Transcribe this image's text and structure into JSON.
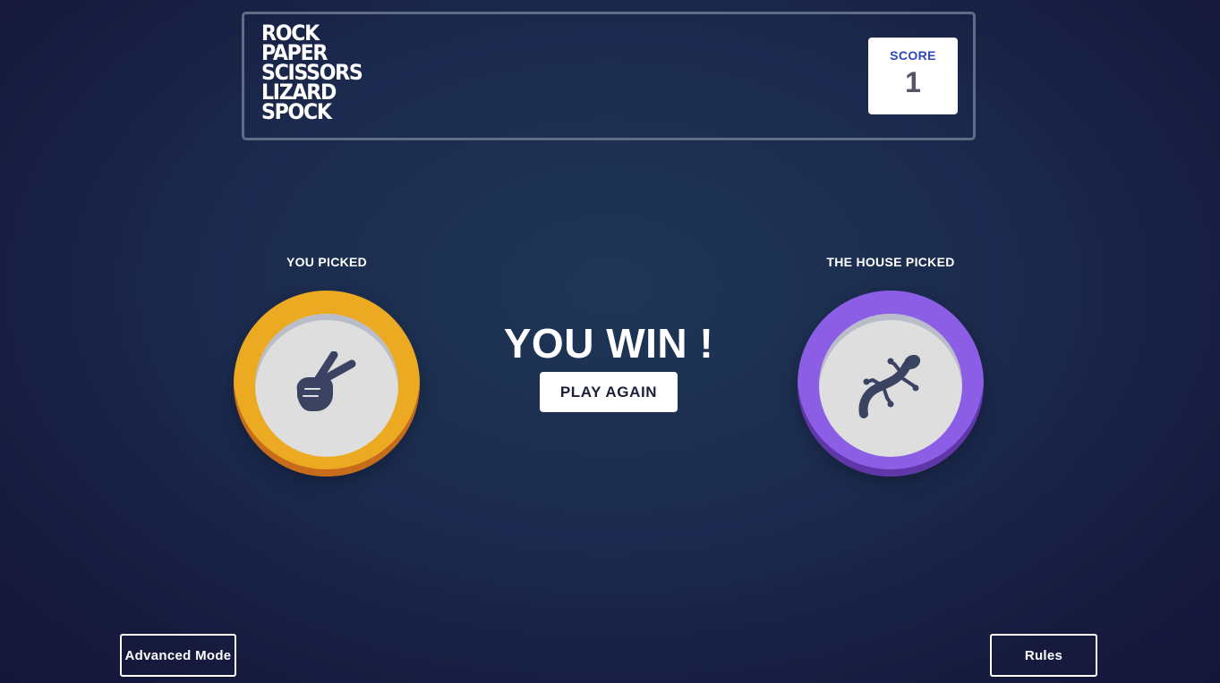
{
  "header": {
    "title_lines": [
      "ROCK",
      "PAPER",
      "SCISSORS",
      "LIZARD",
      "SPOCK"
    ],
    "score_label": "SCORE",
    "score_value": "1"
  },
  "game": {
    "you_picked_label": "YOU PICKED",
    "house_picked_label": "THE HOUSE PICKED",
    "player_choice": "scissors",
    "house_choice": "lizard",
    "result_text": "YOU WIN !",
    "play_again_label": "PLAY AGAIN"
  },
  "footer": {
    "advanced_mode_label": "Advanced Mode",
    "rules_label": "Rules"
  },
  "colors": {
    "scissors": "#eca922",
    "lizard": "#8c5de5",
    "icon": "#3b4363",
    "score_label": "#2a46c0",
    "score_value": "#565468"
  },
  "icons": {
    "player_icon": "scissors-hand-icon",
    "house_icon": "lizard-icon"
  }
}
